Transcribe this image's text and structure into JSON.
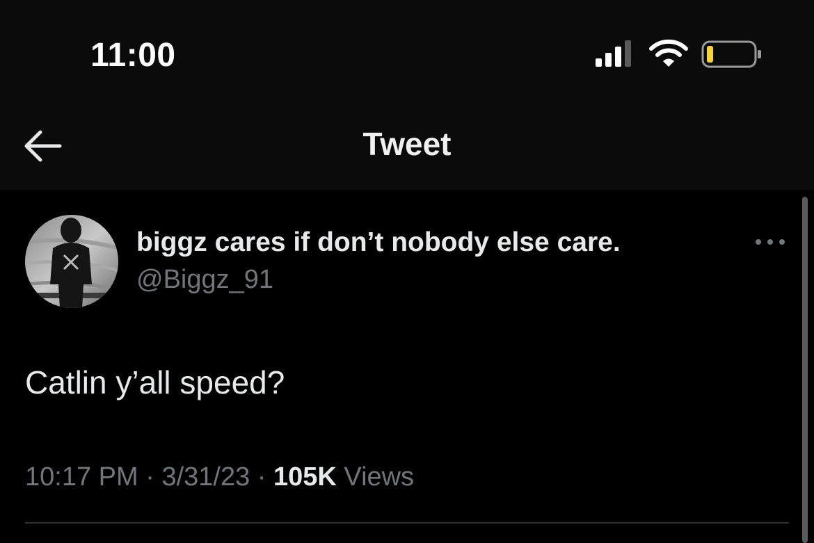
{
  "status_bar": {
    "time": "11:00",
    "icons": [
      "signal-icon",
      "wifi-icon",
      "battery-icon"
    ],
    "battery_color": "#f5d33a"
  },
  "nav": {
    "back_icon": "arrow-left-icon",
    "title": "Tweet"
  },
  "tweet": {
    "author": {
      "display_name": "biggz cares if don’t nobody else care.",
      "handle": "@Biggz_91"
    },
    "more_icon": "more-horizontal-icon",
    "text": "Catlin y’all speed?",
    "time": "10:17 PM",
    "date": "3/31/23",
    "separator": "·",
    "views_count": "105K",
    "views_label": "Views"
  },
  "colors": {
    "background": "#000000",
    "bar_background": "#0b0b0b",
    "primary_text": "#e7e9ea",
    "secondary_text": "#71767b",
    "divider": "#2f3336"
  }
}
